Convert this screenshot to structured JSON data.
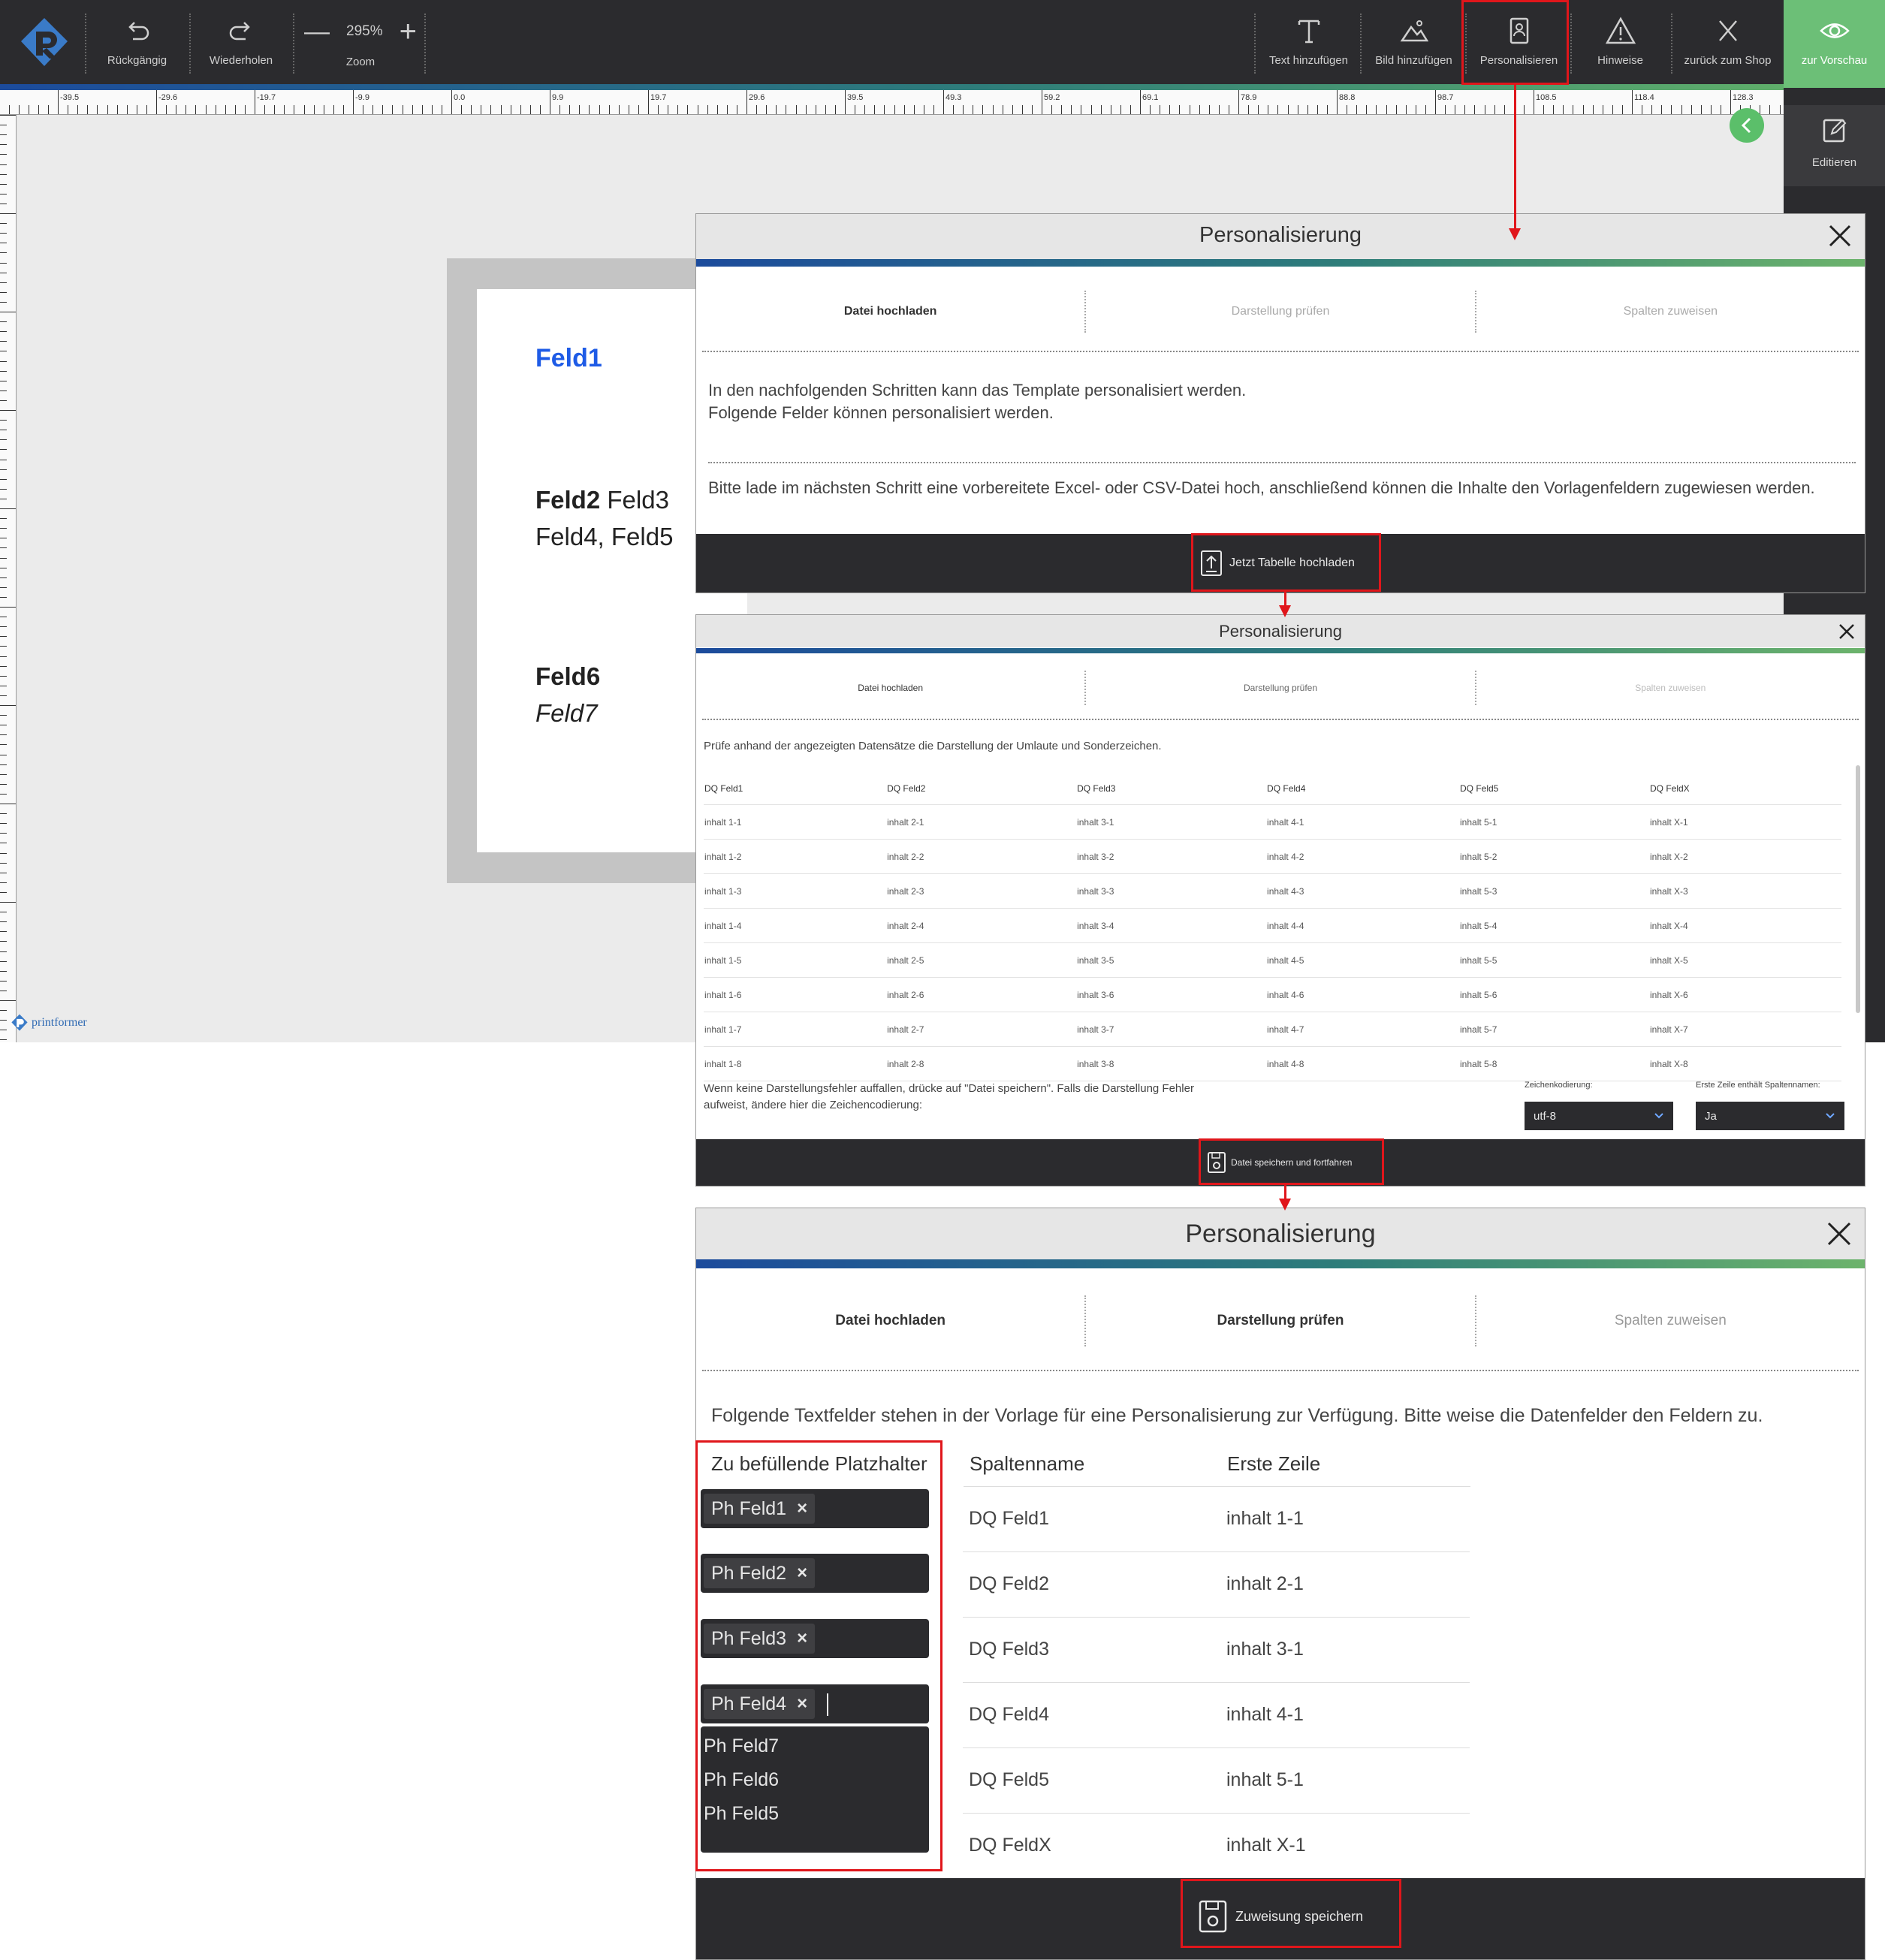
{
  "toolbar": {
    "undo_label": "Rückgängig",
    "redo_label": "Wiederholen",
    "zoom_value": "295%",
    "zoom_label": "Zoom",
    "add_text_label": "Text hinzufügen",
    "add_image_label": "Bild hinzufügen",
    "personalize_label": "Personalisieren",
    "notes_label": "Hinweise",
    "back_to_shop_label": "zurück zum Shop",
    "preview_label": "zur Vorschau"
  },
  "side_panel": {
    "edit_label": "Editieren"
  },
  "ruler": {
    "top_labels": [
      "-39.5",
      "-29.6",
      "-19.7",
      "-9.9",
      "0.0",
      "9.9",
      "19.7",
      "29.6",
      "39.5",
      "49.3",
      "59.2",
      "69.1",
      "78.9",
      "88.8",
      "98.7",
      "108.5",
      "118.4",
      "128.3"
    ]
  },
  "document": {
    "feld1": "Feld1",
    "feld2": "Feld2",
    "feld3": "Feld3",
    "feld45": "Feld4, Feld5",
    "feld6": "Feld6",
    "feld7": "Feld7"
  },
  "brand": {
    "name": "printformer"
  },
  "colors": {
    "accent_green": "#6cbf77",
    "toolbar_dark": "#2b2b2e",
    "highlight_red": "#e0161b",
    "feld1_blue": "#1e5be6"
  },
  "dialog1": {
    "title": "Personalisierung",
    "steps": [
      "Datei hochladen",
      "Darstellung prüfen",
      "Spalten zuweisen"
    ],
    "intro_line1": "In den nachfolgenden Schritten kann das Template personalisiert werden.",
    "intro_line2": "Folgende Felder können personalisiert werden.",
    "instruction": "Bitte lade im nächsten Schritt eine vorbereitete Excel- oder CSV-Datei hoch, anschließend können die Inhalte den Vorlagenfeldern zugewiesen werden.",
    "upload_button": "Jetzt Tabelle hochladen"
  },
  "dialog2": {
    "title": "Personalisierung",
    "steps": [
      "Datei hochladen",
      "Darstellung prüfen",
      "Spalten zuweisen"
    ],
    "intro": "Prüfe anhand der angezeigten Datensätze die Darstellung der Umlaute und Sonderzeichen.",
    "columns": [
      "DQ Feld1",
      "DQ Feld2",
      "DQ Feld3",
      "DQ Feld4",
      "DQ Feld5",
      "DQ FeldX"
    ],
    "rows": [
      [
        "inhalt 1-1",
        "inhalt 2-1",
        "inhalt 3-1",
        "inhalt 4-1",
        "inhalt 5-1",
        "inhalt X-1"
      ],
      [
        "inhalt 1-2",
        "inhalt 2-2",
        "inhalt 3-2",
        "inhalt 4-2",
        "inhalt 5-2",
        "inhalt X-2"
      ],
      [
        "inhalt 1-3",
        "inhalt 2-3",
        "inhalt 3-3",
        "inhalt 4-3",
        "inhalt 5-3",
        "inhalt X-3"
      ],
      [
        "inhalt 1-4",
        "inhalt 2-4",
        "inhalt 3-4",
        "inhalt 4-4",
        "inhalt 5-4",
        "inhalt X-4"
      ],
      [
        "inhalt 1-5",
        "inhalt 2-5",
        "inhalt 3-5",
        "inhalt 4-5",
        "inhalt 5-5",
        "inhalt X-5"
      ],
      [
        "inhalt 1-6",
        "inhalt 2-6",
        "inhalt 3-6",
        "inhalt 4-6",
        "inhalt 5-6",
        "inhalt X-6"
      ],
      [
        "inhalt 1-7",
        "inhalt 2-7",
        "inhalt 3-7",
        "inhalt 4-7",
        "inhalt 5-7",
        "inhalt X-7"
      ],
      [
        "inhalt 1-8",
        "inhalt 2-8",
        "inhalt 3-8",
        "inhalt 4-8",
        "inhalt 5-8",
        "inhalt X-8"
      ]
    ],
    "hint_line1": "Wenn keine Darstellungsfehler auffallen, drücke auf \"Datei speichern\". Falls die Darstellung Fehler",
    "hint_line2": "aufweist, ändere hier die Zeichencodierung:",
    "encoding_label": "Zeichenkodierung:",
    "encoding_value": "utf-8",
    "header_row_label": "Erste Zeile enthält Spaltennamen:",
    "header_row_value": "Ja",
    "save_button": "Datei speichern und fortfahren"
  },
  "dialog3": {
    "title": "Personalisierung",
    "steps": [
      "Datei hochladen",
      "Darstellung prüfen",
      "Spalten zuweisen"
    ],
    "intro": "Folgende Textfelder stehen in der Vorlage für eine Personalisierung zur Verfügung. Bitte weise die Datenfelder den Feldern zu.",
    "col_placeholder": "Zu befüllende Platzhalter",
    "col_column_name": "Spaltenname",
    "col_first_row": "Erste Zeile",
    "chips": [
      "Ph Feld1",
      "Ph Feld2",
      "Ph Feld3",
      "Ph Feld4"
    ],
    "dropdown_options": [
      "Ph Feld7",
      "Ph Feld6",
      "Ph Feld5"
    ],
    "assign_rows": [
      {
        "column": "DQ Feld1",
        "first": "inhalt 1-1"
      },
      {
        "column": "DQ Feld2",
        "first": "inhalt 2-1"
      },
      {
        "column": "DQ Feld3",
        "first": "inhalt 3-1"
      },
      {
        "column": "DQ Feld4",
        "first": "inhalt 4-1"
      },
      {
        "column": "DQ Feld5",
        "first": "inhalt 5-1"
      },
      {
        "column": "DQ FeldX",
        "first": "inhalt X-1"
      }
    ],
    "save_button": "Zuweisung speichern"
  }
}
